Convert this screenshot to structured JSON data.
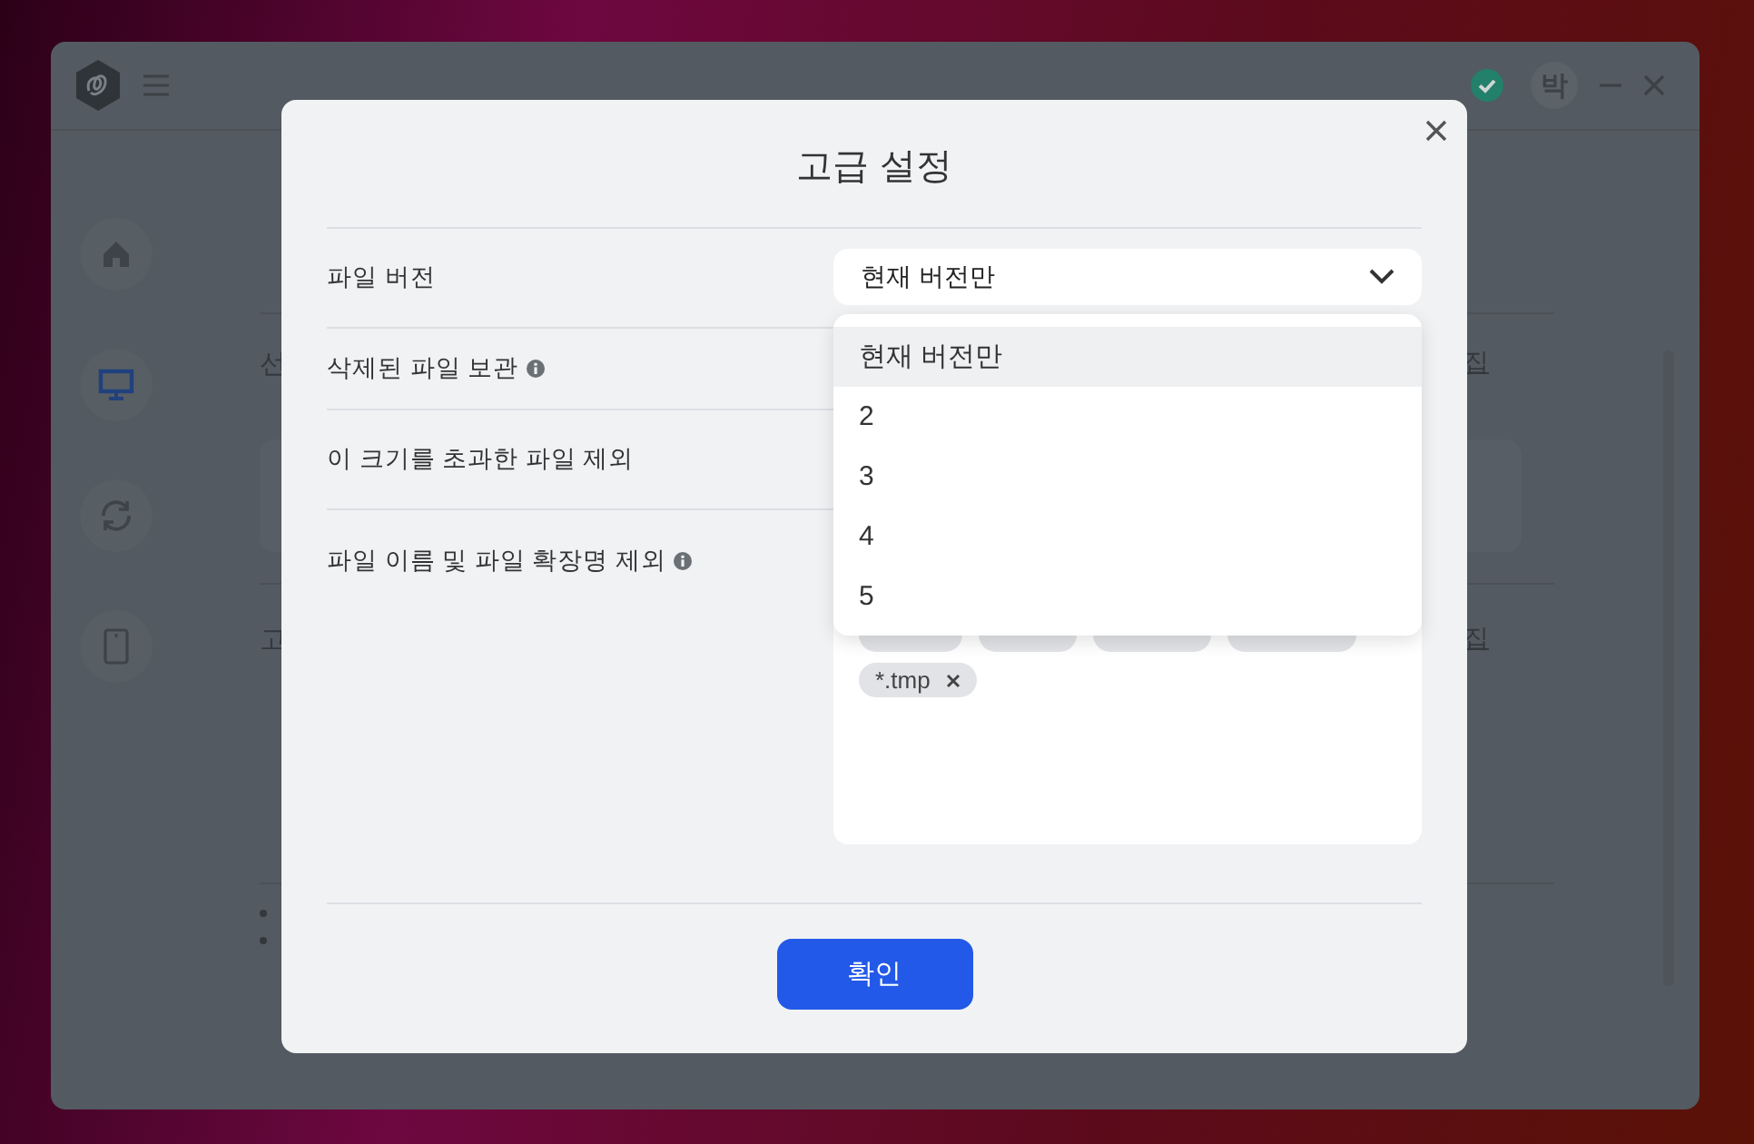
{
  "app": {
    "header": {
      "avatar": "박"
    },
    "sidebar": {
      "items": [
        {
          "kind": "home",
          "selected": false
        },
        {
          "kind": "monitor",
          "selected": true
        },
        {
          "kind": "sync",
          "selected": false
        },
        {
          "kind": "phone",
          "selected": false
        }
      ]
    },
    "sections": [
      {
        "heading": "선",
        "link": "집"
      },
      {
        "heading": "고",
        "link": "집"
      }
    ]
  },
  "dialog": {
    "title": "고급 설정",
    "settings": [
      {
        "kind": "select",
        "label": "파일 버전",
        "info": false,
        "value": "현재 버전만"
      },
      {
        "kind": "plain",
        "label": "삭제된 파일 보관",
        "info": true
      },
      {
        "kind": "plain",
        "label": "이 크기를 초과한 파일 제외",
        "info": false
      },
      {
        "kind": "tags",
        "label": "파일 이름 및 파일 확장명 제외",
        "info": true,
        "tags": [
          "*.tmp"
        ]
      }
    ],
    "dropdown": {
      "options": [
        {
          "label": "현재 버전만",
          "selected": true
        },
        {
          "label": "2",
          "selected": false
        },
        {
          "label": "3",
          "selected": false
        },
        {
          "label": "4",
          "selected": false
        },
        {
          "label": "5",
          "selected": false
        }
      ]
    },
    "confirm": "확인"
  }
}
